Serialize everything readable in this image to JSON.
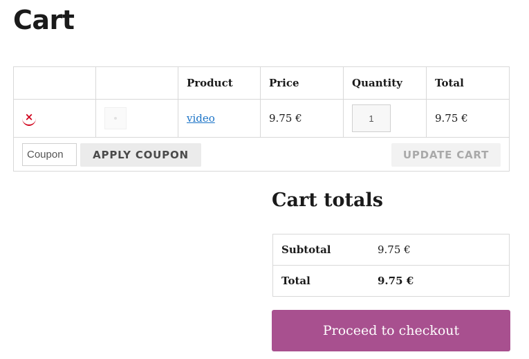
{
  "page": {
    "title": "Cart"
  },
  "cart_table": {
    "headers": [
      "",
      "",
      "Product",
      "Price",
      "Quantity",
      "Total"
    ],
    "items": [
      {
        "remove_symbol": "×",
        "product": "video",
        "price": "9.75 €",
        "quantity": "1",
        "total": "9.75 €"
      }
    ]
  },
  "actions": {
    "coupon_placeholder": "Coupon",
    "apply_coupon_label": "APPLY COUPON",
    "update_cart_label": "UPDATE CART"
  },
  "cart_totals": {
    "heading": "Cart totals",
    "rows": [
      {
        "label": "Subtotal",
        "value": "9.75 €"
      },
      {
        "label": "Total",
        "value": "9.75 €"
      }
    ]
  },
  "checkout": {
    "label": "Proceed to checkout"
  },
  "colors": {
    "checkout_button": "#a8508f",
    "remove_icon": "#d0021b",
    "product_link": "#1a73c7"
  },
  "icons": {
    "remove": "close-icon",
    "thumbnail": "product-thumbnail-placeholder"
  }
}
